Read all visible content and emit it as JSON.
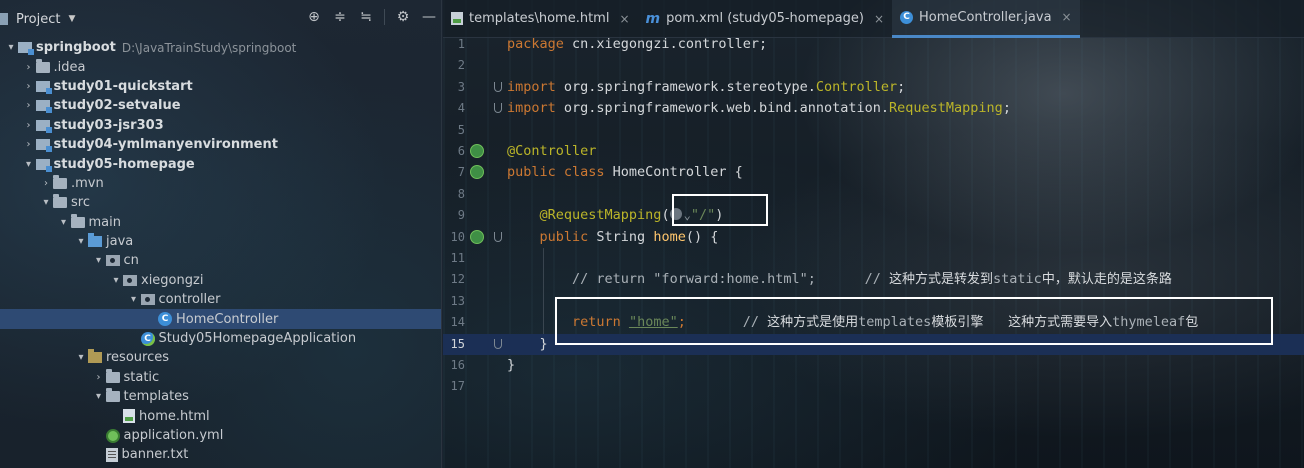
{
  "project_panel": {
    "title": "Project",
    "tools": [
      "target-icon",
      "expand-icon",
      "collapse-icon",
      "gear-icon",
      "minimize-icon"
    ],
    "tree": [
      {
        "label": "springboot",
        "path": "D:\\JavaTrainStudy\\springboot",
        "kind": "module",
        "arrow": "▾",
        "indent": 0,
        "bold": true
      },
      {
        "label": ".idea",
        "kind": "folder",
        "arrow": "›",
        "indent": 1
      },
      {
        "label": "study01-quickstart",
        "kind": "module",
        "arrow": "›",
        "indent": 1,
        "bold": true
      },
      {
        "label": "study02-setvalue",
        "kind": "module",
        "arrow": "›",
        "indent": 1,
        "bold": true
      },
      {
        "label": "study03-jsr303",
        "kind": "module",
        "arrow": "›",
        "indent": 1,
        "bold": true
      },
      {
        "label": "study04-ymlmanyenvironment",
        "kind": "module",
        "arrow": "›",
        "indent": 1,
        "bold": true
      },
      {
        "label": "study05-homepage",
        "kind": "module",
        "arrow": "▾",
        "indent": 1,
        "bold": true
      },
      {
        "label": ".mvn",
        "kind": "folder",
        "arrow": "›",
        "indent": 2
      },
      {
        "label": "src",
        "kind": "folder",
        "arrow": "▾",
        "indent": 2
      },
      {
        "label": "main",
        "kind": "folder",
        "arrow": "▾",
        "indent": 3
      },
      {
        "label": "java",
        "kind": "src",
        "arrow": "▾",
        "indent": 4
      },
      {
        "label": "cn",
        "kind": "pkg",
        "arrow": "▾",
        "indent": 5
      },
      {
        "label": "xiegongzi",
        "kind": "pkg",
        "arrow": "▾",
        "indent": 6
      },
      {
        "label": "controller",
        "kind": "pkg",
        "arrow": "▾",
        "indent": 7
      },
      {
        "label": "HomeController",
        "kind": "class",
        "arrow": "",
        "indent": 8,
        "selected": true
      },
      {
        "label": "Study05HomepageApplication",
        "kind": "app",
        "arrow": "",
        "indent": 7
      },
      {
        "label": "resources",
        "kind": "res",
        "arrow": "▾",
        "indent": 4
      },
      {
        "label": "static",
        "kind": "folder",
        "arrow": "›",
        "indent": 5
      },
      {
        "label": "templates",
        "kind": "folder",
        "arrow": "▾",
        "indent": 5
      },
      {
        "label": "home.html",
        "kind": "html",
        "arrow": "",
        "indent": 6
      },
      {
        "label": "application.yml",
        "kind": "yml",
        "arrow": "",
        "indent": 5
      },
      {
        "label": "banner.txt",
        "kind": "txt",
        "arrow": "",
        "indent": 5
      }
    ]
  },
  "tabs": [
    {
      "label": "templates\\home.html",
      "icon": "html-file-icon",
      "active": false
    },
    {
      "label": "pom.xml (study05-homepage)",
      "icon": "maven-icon",
      "active": false
    },
    {
      "label": "HomeController.java",
      "icon": "class-icon",
      "active": true
    }
  ],
  "tab_close": "×",
  "editor": {
    "current_line": 15,
    "lines": [
      {
        "n": "1",
        "code": [
          [
            "kw",
            "package "
          ],
          [
            "pl",
            "cn.xiegongzi.controller;"
          ]
        ]
      },
      {
        "n": "2",
        "code": []
      },
      {
        "n": "3",
        "code": [
          [
            "kw",
            "import "
          ],
          [
            "pl",
            "org.springframework.stereotype."
          ],
          [
            "im",
            "Controller"
          ],
          [
            "pl",
            ";"
          ]
        ]
      },
      {
        "n": "4",
        "code": [
          [
            "kw",
            "import "
          ],
          [
            "pl",
            "org.springframework.web.bind.annotation."
          ],
          [
            "im",
            "RequestMapping"
          ],
          [
            "pl",
            ";"
          ]
        ]
      },
      {
        "n": "5",
        "code": []
      },
      {
        "n": "6",
        "code": [
          [
            "an",
            "@Controller"
          ]
        ]
      },
      {
        "n": "7",
        "code": [
          [
            "kw",
            "public class "
          ],
          [
            "pl",
            "HomeController {"
          ]
        ]
      },
      {
        "n": "8",
        "code": []
      },
      {
        "n": "9",
        "code": [
          [
            "pl",
            "    "
          ],
          [
            "an",
            "@RequestMapping"
          ],
          [
            "pl",
            "("
          ],
          [
            "hint",
            ""
          ],
          [
            "st",
            "\"/\""
          ],
          [
            "pl",
            ")"
          ]
        ]
      },
      {
        "n": "10",
        "code": [
          [
            "pl",
            "    "
          ],
          [
            "kw",
            "public "
          ],
          [
            "pl",
            "String "
          ],
          [
            "fn",
            "home"
          ],
          [
            "pl",
            "() {"
          ]
        ]
      },
      {
        "n": "11",
        "code": []
      },
      {
        "n": "12",
        "code": [
          [
            "pl",
            "        "
          ],
          [
            "cm",
            "// return \"forward:home.html\";      // "
          ],
          [
            "cmcn",
            "这种方式是转发到"
          ],
          [
            "cm",
            "static"
          ],
          [
            "cmcn",
            "中，默认走的是这条路"
          ]
        ]
      },
      {
        "n": "13",
        "code": []
      },
      {
        "n": "14",
        "code": [
          [
            "pl",
            "        "
          ],
          [
            "kw",
            "return "
          ],
          [
            "stl",
            "\"home\""
          ],
          [
            "kw",
            ";"
          ],
          [
            "cm",
            "       // "
          ],
          [
            "cmcn",
            "这种方式是使用"
          ],
          [
            "cm",
            "templates"
          ],
          [
            "cmcn",
            "模板引擎      这种方式需要导入"
          ],
          [
            "cm",
            "thymeleaf"
          ],
          [
            "cmcn",
            "包"
          ]
        ]
      },
      {
        "n": "15",
        "code": [
          [
            "pl",
            "    }"
          ]
        ]
      },
      {
        "n": "16",
        "code": [
          [
            "pl",
            "}"
          ]
        ]
      },
      {
        "n": "17",
        "code": []
      }
    ]
  }
}
